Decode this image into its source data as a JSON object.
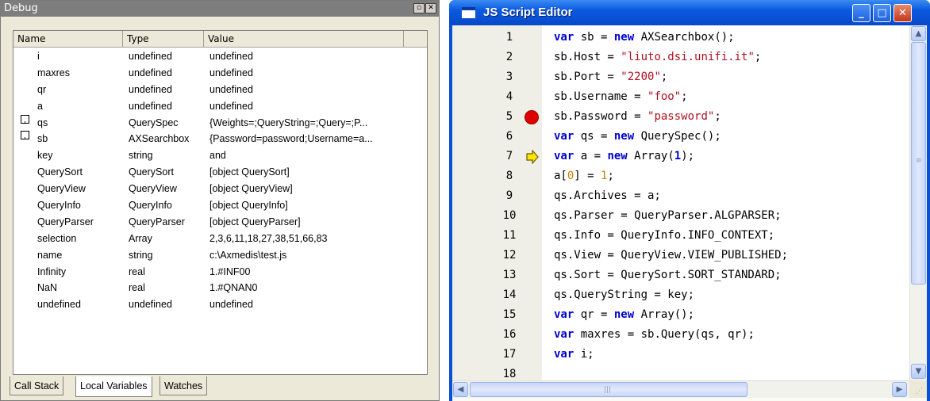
{
  "debug": {
    "title": "Debug",
    "columns": {
      "name": "Name",
      "type": "Type",
      "value": "Value"
    },
    "rows": [
      {
        "name": "i",
        "type": "undefined",
        "value": "undefined",
        "expandable": false
      },
      {
        "name": "maxres",
        "type": "undefined",
        "value": "undefined",
        "expandable": false
      },
      {
        "name": "qr",
        "type": "undefined",
        "value": "undefined",
        "expandable": false
      },
      {
        "name": "a",
        "type": "undefined",
        "value": "undefined",
        "expandable": false
      },
      {
        "name": "qs",
        "type": "QuerySpec",
        "value": "{Weights=;QueryString=;Query=;P...",
        "expandable": true
      },
      {
        "name": "sb",
        "type": "AXSearchbox",
        "value": "{Password=password;Username=a...",
        "expandable": true
      },
      {
        "name": "key",
        "type": "string",
        "value": "and",
        "expandable": false
      },
      {
        "name": "QuerySort",
        "type": "QuerySort",
        "value": "[object QuerySort]",
        "expandable": false
      },
      {
        "name": "QueryView",
        "type": "QueryView",
        "value": "[object QueryView]",
        "expandable": false
      },
      {
        "name": "QueryInfo",
        "type": "QueryInfo",
        "value": "[object QueryInfo]",
        "expandable": false
      },
      {
        "name": "QueryParser",
        "type": "QueryParser",
        "value": "[object QueryParser]",
        "expandable": false
      },
      {
        "name": "selection",
        "type": "Array",
        "value": "2,3,6,11,18,27,38,51,66,83",
        "expandable": false
      },
      {
        "name": "name",
        "type": "string",
        "value": "c:\\Axmedis\\test.js",
        "expandable": false
      },
      {
        "name": "Infinity",
        "type": "real",
        "value": "1.#INF00",
        "expandable": false
      },
      {
        "name": "NaN",
        "type": "real",
        "value": "1.#QNAN0",
        "expandable": false
      },
      {
        "name": "undefined",
        "type": "undefined",
        "value": "undefined",
        "expandable": false
      }
    ],
    "tabs": [
      "Call Stack",
      "Local Variables",
      "Watches"
    ],
    "active_tab": "Local Variables",
    "expander_glyph": "+",
    "window_buttons": [
      "▫",
      "✕"
    ]
  },
  "editor": {
    "title": "JS Script Editor",
    "window_buttons": {
      "minimize": "_",
      "maximize": "□",
      "close": "✕"
    },
    "breakpoint_line": 5,
    "current_line": 7,
    "lines": [
      {
        "n": "1",
        "tokens": [
          [
            "kw",
            "var"
          ],
          [
            "",
            " sb = "
          ],
          [
            "kw",
            "new"
          ],
          [
            "",
            " AXSearchbox();"
          ]
        ]
      },
      {
        "n": "2",
        "tokens": [
          [
            "",
            "sb.Host = "
          ],
          [
            "str",
            "\"liuto.dsi.unifi.it\""
          ],
          [
            "",
            ";"
          ]
        ]
      },
      {
        "n": "3",
        "tokens": [
          [
            "",
            "sb.Port = "
          ],
          [
            "str",
            "\"2200\""
          ],
          [
            "",
            ";"
          ]
        ]
      },
      {
        "n": "4",
        "tokens": [
          [
            "",
            "sb.Username = "
          ],
          [
            "str",
            "\"foo\""
          ],
          [
            "",
            ";"
          ]
        ]
      },
      {
        "n": "5",
        "tokens": [
          [
            "",
            "sb.Password = "
          ],
          [
            "str",
            "\"password\""
          ],
          [
            "",
            ";"
          ]
        ]
      },
      {
        "n": "6",
        "tokens": [
          [
            "kw",
            "var"
          ],
          [
            "",
            " qs = "
          ],
          [
            "kw",
            "new"
          ],
          [
            "",
            " QuerySpec();"
          ]
        ]
      },
      {
        "n": "7",
        "tokens": [
          [
            "kw",
            "var"
          ],
          [
            "",
            " a = "
          ],
          [
            "kw",
            "new"
          ],
          [
            "",
            " Array("
          ],
          [
            "kw",
            "1"
          ],
          [
            "",
            ");"
          ]
        ]
      },
      {
        "n": "8",
        "tokens": [
          [
            "",
            "a["
          ],
          [
            "num",
            "0"
          ],
          [
            "",
            "] = "
          ],
          [
            "num",
            "1"
          ],
          [
            "",
            ";"
          ]
        ]
      },
      {
        "n": "9",
        "tokens": [
          [
            "",
            "qs.Archives = a;"
          ]
        ]
      },
      {
        "n": "10",
        "tokens": [
          [
            "",
            "qs.Parser = QueryParser.ALGPARSER;"
          ]
        ]
      },
      {
        "n": "11",
        "tokens": [
          [
            "",
            "qs.Info = QueryInfo.INFO_CONTEXT;"
          ]
        ]
      },
      {
        "n": "12",
        "tokens": [
          [
            "",
            "qs.View = QueryView.VIEW_PUBLISHED;"
          ]
        ]
      },
      {
        "n": "13",
        "tokens": [
          [
            "",
            "qs.Sort = QuerySort.SORT_STANDARD;"
          ]
        ]
      },
      {
        "n": "14",
        "tokens": [
          [
            "",
            "qs.QueryString = key;"
          ]
        ]
      },
      {
        "n": "15",
        "tokens": [
          [
            "kw",
            "var"
          ],
          [
            "",
            " qr = "
          ],
          [
            "kw",
            "new"
          ],
          [
            "",
            " Array();"
          ]
        ]
      },
      {
        "n": "16",
        "tokens": [
          [
            "kw",
            "var"
          ],
          [
            "",
            " maxres = sb.Query(qs, qr);"
          ]
        ]
      },
      {
        "n": "17",
        "tokens": [
          [
            "kw",
            "var"
          ],
          [
            "",
            " i;"
          ]
        ]
      },
      {
        "n": "18",
        "tokens": []
      }
    ]
  },
  "icons": {
    "breakpoint": "breakpoint-icon",
    "current_line": "current-line-arrow-icon",
    "editor_app": "editor-app-icon"
  }
}
